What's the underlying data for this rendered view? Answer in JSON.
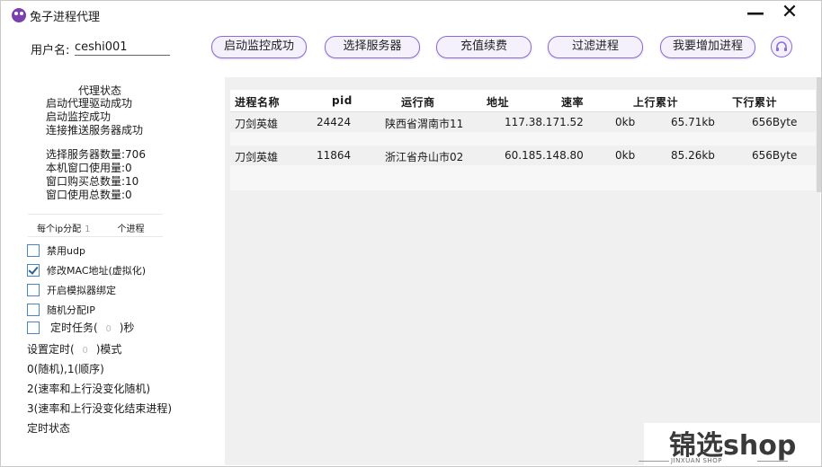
{
  "window": {
    "title": "兔子进程代理",
    "minimize": "—",
    "close": "✕"
  },
  "user": {
    "label": "用户名:",
    "value": "ceshi001"
  },
  "toolbar": [
    {
      "label": "启动监控成功"
    },
    {
      "label": "选择服务器"
    },
    {
      "label": "充值续费"
    },
    {
      "label": "过滤进程"
    },
    {
      "label": "我要增加进程"
    }
  ],
  "sidebar": {
    "status_title": "代理状态",
    "status_lines": [
      "启动代理驱动成功",
      "启动监控成功",
      "连接推送服务器成功"
    ],
    "stats": [
      "选择服务器数量:706",
      "本机窗口使用量:0",
      "窗口购买总数量:10",
      "窗口使用总数量:0"
    ],
    "per_ip": {
      "label": "每个ip分配",
      "value": "1",
      "suffix": "个进程"
    },
    "options": [
      {
        "label": "禁用udp",
        "checked": false
      },
      {
        "label": "修改MAC地址(虚拟化)",
        "checked": true
      },
      {
        "label": "开启模拟器绑定",
        "checked": false
      },
      {
        "label": "随机分配IP",
        "checked": false
      }
    ],
    "timer": {
      "label": "定时任务(",
      "value": "0",
      "suffix": ")秒"
    },
    "mode": {
      "label": "设置定时(",
      "value": "0",
      "suffix": ")模式"
    },
    "mode_lines": [
      "0(随机),1(顺序)",
      "2(速率和上行没变化随机)",
      "3(速率和上行没变化结束进程)"
    ],
    "timer_status": "定时状态"
  },
  "table": {
    "columns": [
      "进程名称",
      "pid",
      "运行商",
      "地址",
      "速率",
      "上行累计",
      "下行累计"
    ],
    "rows": [
      [
        "刀剑英雄",
        "24424",
        "陕西省渭南市11",
        "117.38.171.52",
        "0kb",
        "65.71kb",
        "656Byte"
      ],
      [
        "刀剑英雄",
        "11864",
        "浙江省舟山市02",
        "60.185.148.80",
        "0kb",
        "85.26kb",
        "656Byte"
      ]
    ]
  },
  "watermark": {
    "text": "锦选shop",
    "sub": "JINXUAN SHOP"
  },
  "colors": {
    "accent": "#8d6ad8",
    "icon": "#7b3fb0",
    "checkbox": "#4a86c5"
  }
}
